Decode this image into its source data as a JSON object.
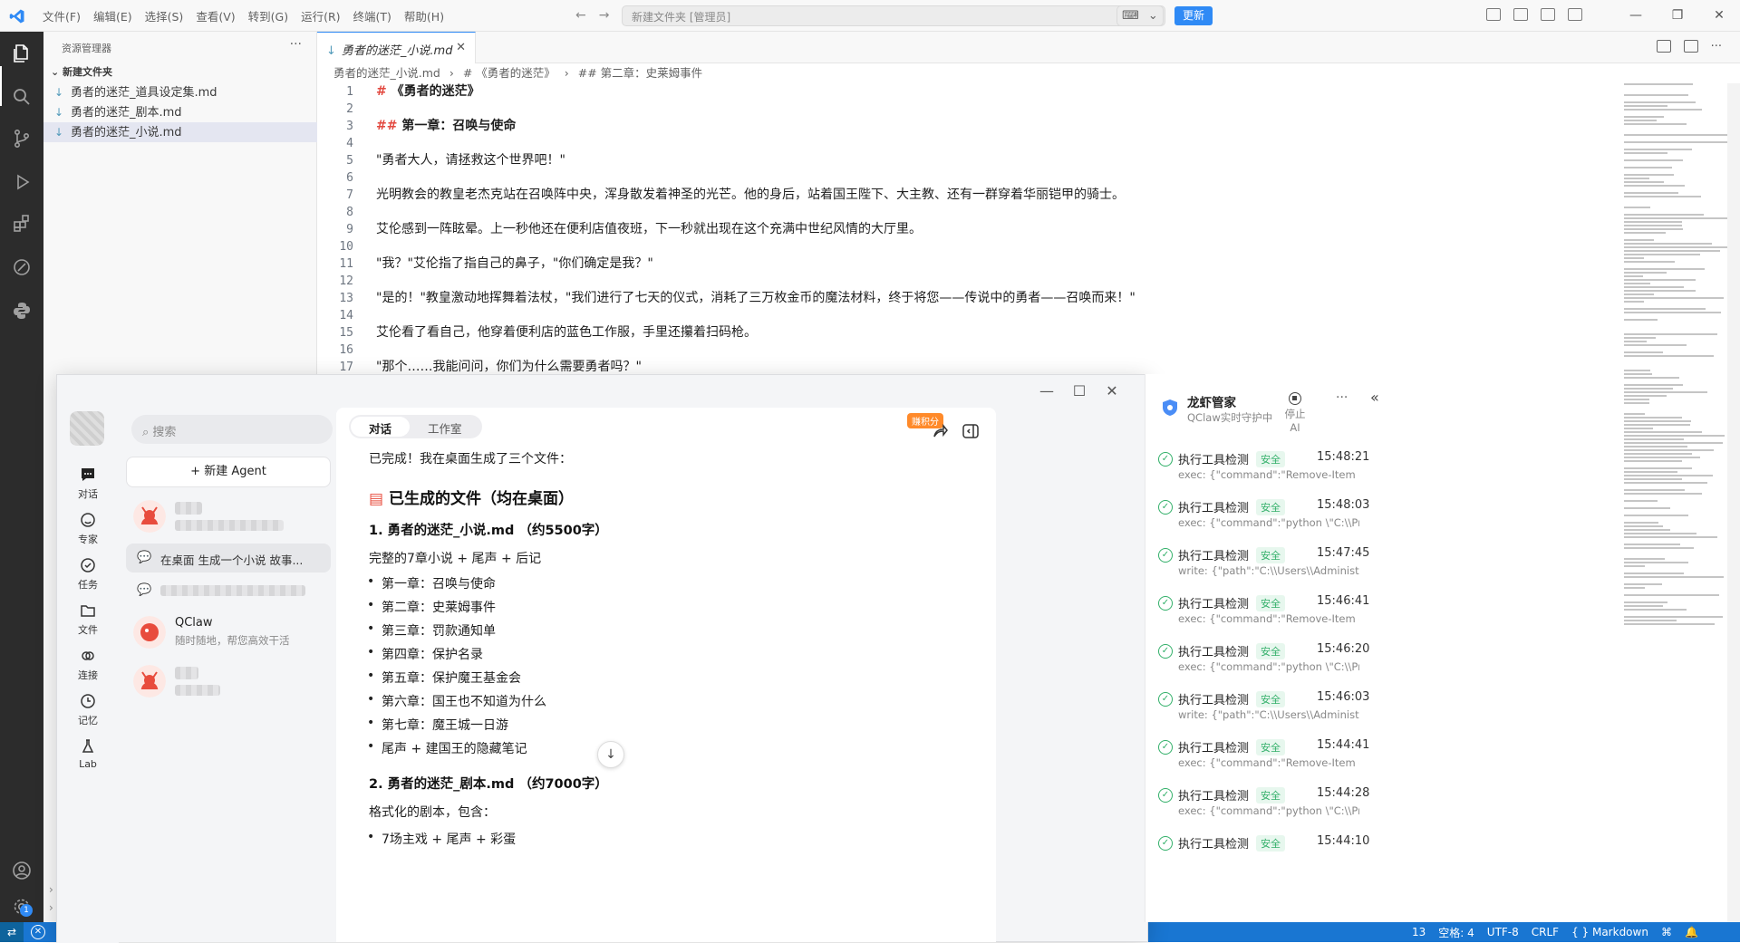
{
  "vscode": {
    "menu": [
      "文件(F)",
      "编辑(E)",
      "选择(S)",
      "查看(V)",
      "转到(G)",
      "运行(R)",
      "终端(T)",
      "帮助(H)"
    ],
    "command_center": "新建文件夹 [管理员]",
    "update_label": "更新",
    "explorer_title": "资源管理器",
    "folder_name": "新建文件夹",
    "files": [
      "勇者的迷茫_道具设定集.md",
      "勇者的迷茫_剧本.md",
      "勇者的迷茫_小说.md"
    ],
    "active_tab": "勇者的迷茫_小说.md",
    "breadcrumb": [
      "勇者的迷茫_小说.md",
      "# 《勇者的迷茫》",
      "## 第二章：史莱姆事件"
    ],
    "lines": [
      {
        "n": "1",
        "hash": "#",
        "text": "《勇者的迷茫》",
        "heading": true
      },
      {
        "n": "2",
        "hash": "",
        "text": "",
        "heading": false
      },
      {
        "n": "3",
        "hash": "##",
        "text": "第一章：召唤与使命",
        "heading": true
      },
      {
        "n": "4",
        "hash": "",
        "text": "",
        "heading": false
      },
      {
        "n": "5",
        "hash": "",
        "text": "\"勇者大人，请拯救这个世界吧！\"",
        "heading": false
      },
      {
        "n": "6",
        "hash": "",
        "text": "",
        "heading": false
      },
      {
        "n": "7",
        "hash": "",
        "text": "光明教会的教皇老杰克站在召唤阵中央，浑身散发着神圣的光芒。他的身后，站着国王陛下、大主教、还有一群穿着华丽铠甲的骑士。",
        "heading": false
      },
      {
        "n": "8",
        "hash": "",
        "text": "",
        "heading": false
      },
      {
        "n": "9",
        "hash": "",
        "text": "艾伦感到一阵眩晕。上一秒他还在便利店值夜班，下一秒就出现在这个充满中世纪风情的大厅里。",
        "heading": false
      },
      {
        "n": "10",
        "hash": "",
        "text": "",
        "heading": false
      },
      {
        "n": "11",
        "hash": "",
        "text": "\"我？\"艾伦指了指自己的鼻子，\"你们确定是我？\"",
        "heading": false
      },
      {
        "n": "12",
        "hash": "",
        "text": "",
        "heading": false
      },
      {
        "n": "13",
        "hash": "",
        "text": "\"是的！\"教皇激动地挥舞着法杖，\"我们进行了七天的仪式，消耗了三万枚金币的魔法材料，终于将您——传说中的勇者——召唤而来！\"",
        "heading": false
      },
      {
        "n": "14",
        "hash": "",
        "text": "",
        "heading": false
      },
      {
        "n": "15",
        "hash": "",
        "text": "艾伦看了看自己，他穿着便利店的蓝色工作服，手里还攥着扫码枪。",
        "heading": false
      },
      {
        "n": "16",
        "hash": "",
        "text": "",
        "heading": false
      },
      {
        "n": "17",
        "hash": "",
        "text": "\"那个……我能问问，你们为什么需要勇者吗？\"",
        "heading": false
      }
    ],
    "status_right": [
      "13",
      "空格: 4",
      "UTF-8",
      "CRLF",
      "{ } Markdown"
    ],
    "status_badge": "1"
  },
  "qclaw": {
    "rail": [
      "对话",
      "专家",
      "任务",
      "文件",
      "连接",
      "记忆",
      "Lab"
    ],
    "search_placeholder": "搜索",
    "new_agent": "+ 新建 Agent",
    "active_session": "在桌面 生成一个小说 故事...",
    "qclaw_name": "QClaw",
    "qclaw_sub": "随时随地，帮您高效干活",
    "tabs": [
      "对话",
      "工作室"
    ],
    "credit_label": "赚积分",
    "intro": "已完成！我在桌面生成了三个文件：",
    "section_title": "已生成的文件（均在桌面）",
    "file1_title": "1. 勇者的迷茫_小说.md （约5500字）",
    "file1_desc": "完整的7章小说 + 尾声 + 后记",
    "chapters": [
      "第一章：召唤与使命",
      "第二章：史莱姆事件",
      "第三章：罚款通知单",
      "第四章：保护名录",
      "第五章：保护魔王基金会",
      "第六章：国王也不知道为什么",
      "第七章：魔王城一日游",
      "尾声 + 建国王的隐藏笔记"
    ],
    "file2_title": "2. 勇者的迷茫_剧本.md （约7000字）",
    "file2_desc": "格式化的剧本，包含：",
    "file2_items": [
      "7场主戏 + 尾声 + 彩蛋"
    ]
  },
  "guard": {
    "title": "龙虾管家",
    "subtitle": "QClaw实时守护中",
    "stop_label": "停止AI",
    "items": [
      {
        "name": "执行工具检测",
        "status": "安全",
        "time": "15:48:21",
        "cmd": "exec: {\"command\":\"Remove-Item -Force..."
      },
      {
        "name": "执行工具检测",
        "status": "安全",
        "time": "15:48:03",
        "cmd": "exec: {\"command\":\"python \\\"C:\\\\Progra..."
      },
      {
        "name": "执行工具检测",
        "status": "安全",
        "time": "15:47:45",
        "cmd": "write: {\"path\":\"C:\\\\Users\\\\Administrator\\..."
      },
      {
        "name": "执行工具检测",
        "status": "安全",
        "time": "15:46:41",
        "cmd": "exec: {\"command\":\"Remove-Item -Force..."
      },
      {
        "name": "执行工具检测",
        "status": "安全",
        "time": "15:46:20",
        "cmd": "exec: {\"command\":\"python \\\"C:\\\\Progra..."
      },
      {
        "name": "执行工具检测",
        "status": "安全",
        "time": "15:46:03",
        "cmd": "write: {\"path\":\"C:\\\\Users\\\\Administrator\\..."
      },
      {
        "name": "执行工具检测",
        "status": "安全",
        "time": "15:44:41",
        "cmd": "exec: {\"command\":\"Remove-Item -Force..."
      },
      {
        "name": "执行工具检测",
        "status": "安全",
        "time": "15:44:28",
        "cmd": "exec: {\"command\":\"python \\\"C:\\\\Progra..."
      },
      {
        "name": "执行工具检测",
        "status": "安全",
        "time": "15:44:10",
        "cmd": ""
      }
    ]
  },
  "colors": {
    "vscode_blue": "#1976d2",
    "accent": "#2f8af5",
    "safe_green": "#33b06a"
  }
}
